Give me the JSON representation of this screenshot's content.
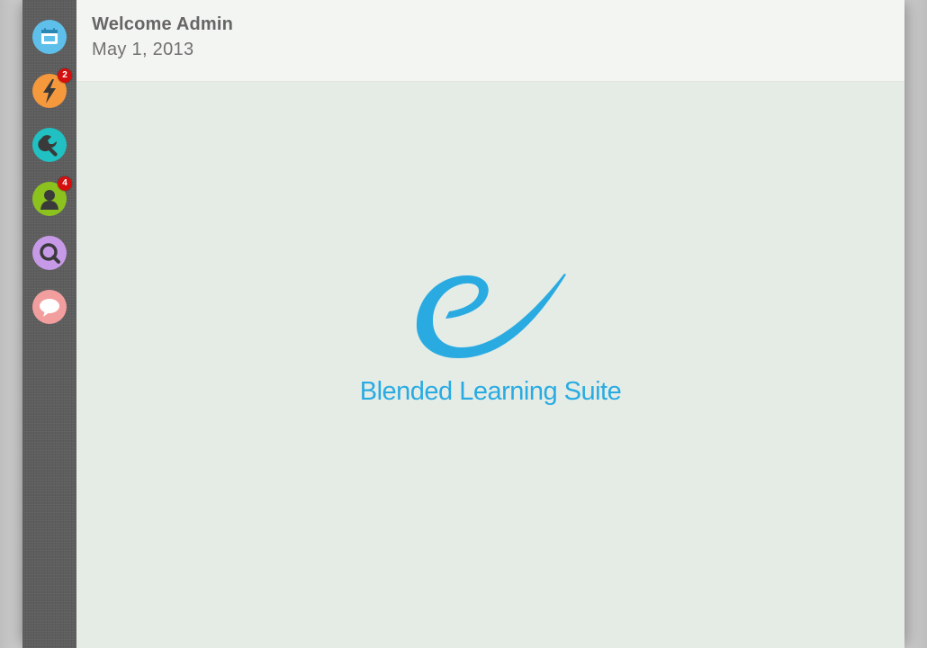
{
  "header": {
    "welcome": "Welcome Admin",
    "date": "May 1, 2013"
  },
  "sidebar": {
    "items": [
      {
        "id": "calendar",
        "icon": "calendar-icon",
        "color": "#5ec0ea",
        "badge": null
      },
      {
        "id": "activity",
        "icon": "lightning-icon",
        "color": "#f6983c",
        "badge": "2"
      },
      {
        "id": "tools",
        "icon": "wrench-icon",
        "color": "#21c0c2",
        "badge": null
      },
      {
        "id": "users",
        "icon": "user-icon",
        "color": "#8cc21e",
        "badge": "4"
      },
      {
        "id": "search",
        "icon": "search-icon",
        "color": "#c79ae8",
        "badge": null
      },
      {
        "id": "chat",
        "icon": "chat-bubble-icon",
        "color": "#f39e9e",
        "badge": null
      }
    ]
  },
  "logo": {
    "text": "Blended Learning Suite",
    "color": "#29abe2"
  },
  "colors": {
    "sidebar": "#5e5e5e",
    "header": "#f3f5f2",
    "content": "#e5ece6",
    "badge": "#d40f0f"
  }
}
